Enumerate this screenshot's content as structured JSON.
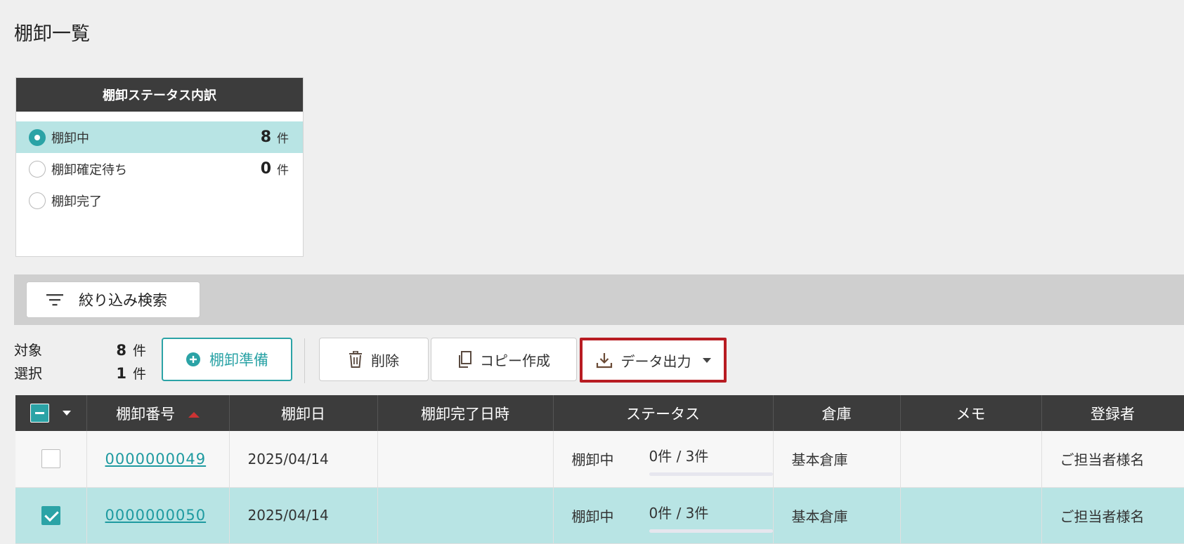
{
  "page": {
    "title": "棚卸一覧"
  },
  "status_panel": {
    "header": "棚卸ステータス内訳",
    "items": [
      {
        "label": "棚卸中",
        "count": "8",
        "unit": "件",
        "selected": true
      },
      {
        "label": "棚卸確定待ち",
        "count": "0",
        "unit": "件",
        "selected": false
      },
      {
        "label": "棚卸完了",
        "count": "",
        "unit": "",
        "selected": false
      }
    ]
  },
  "filter": {
    "label": "絞り込み検索"
  },
  "counts": {
    "target_label": "対象",
    "target_value": "8",
    "target_unit": "件",
    "selected_label": "選択",
    "selected_value": "1",
    "selected_unit": "件"
  },
  "toolbar": {
    "prepare_label": "棚卸準備",
    "delete_label": "削除",
    "copy_label": "コピー作成",
    "export_label": "データ出力"
  },
  "table": {
    "headers": {
      "number": "棚卸番号",
      "date": "棚卸日",
      "completed_at": "棚卸完了日時",
      "status": "ステータス",
      "warehouse": "倉庫",
      "memo": "メモ",
      "registrant": "登録者"
    },
    "rows": [
      {
        "checked": false,
        "number": "0000000049",
        "date": "2025/04/14",
        "completed_at": "",
        "status": "棚卸中",
        "progress_text": "0件 / 3件",
        "progress": 0,
        "warehouse": "基本倉庫",
        "memo": "",
        "registrant": "ご担当者様名"
      },
      {
        "checked": true,
        "number": "0000000050",
        "date": "2025/04/14",
        "completed_at": "",
        "status": "棚卸中",
        "progress_text": "0件 / 3件",
        "progress": 0,
        "warehouse": "基本倉庫",
        "memo": "",
        "registrant": "ご担当者様名"
      }
    ]
  },
  "colors": {
    "accent": "#2ba3a6",
    "highlight": "#b81c22",
    "selected_row": "#b8e4e4"
  }
}
